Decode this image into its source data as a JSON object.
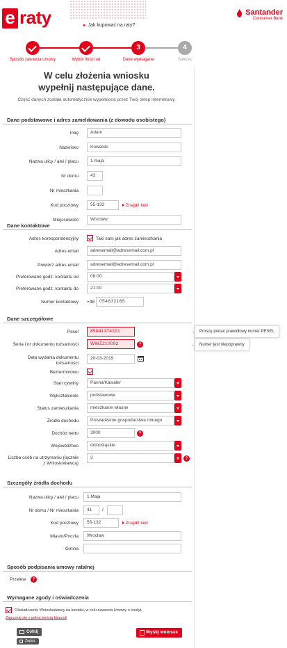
{
  "header": {
    "logo_letter": "e",
    "logo_rest": "raty",
    "howto_link": "Jak kupować na raty?",
    "brand_name": "Santander",
    "brand_sub": "Consumer Bank"
  },
  "steps": [
    {
      "number": "1",
      "label": "Sposób zawarcia umowy",
      "state": "done"
    },
    {
      "number": "2",
      "label": "Wybór ilości rat",
      "state": "done"
    },
    {
      "number": "3",
      "label": "Dane wymagane",
      "state": "active"
    },
    {
      "number": "4",
      "label": "Sukces",
      "state": "future"
    }
  ],
  "page": {
    "title_line1": "W celu złożenia wniosku",
    "title_line2": "wypełnij następujące dane.",
    "subtitle": "Część danych została automatycznie wypełniona przez Twój sklep internetowy."
  },
  "sections": {
    "personal": "Dane podstawowe i adres zameldowania (z dowodu osobistego)",
    "contact": "Dane kontaktowe",
    "details": "Dane szczegółowe",
    "income": "Szczegóły źródła dochodu",
    "signing": "Sposób podpisania umowy ratalnej",
    "consents": "Wymagane zgody i oświadczenia"
  },
  "personal": {
    "first_name_label": "Imię",
    "first_name": "Adam",
    "last_name_label": "Nazwisko",
    "last_name": "Kowalski",
    "street_label": "Nazwa ulicy / alei / placu",
    "street": "1 maja",
    "house_label": "Nr domu",
    "house": "43",
    "apartment_label": "Nr mieszkania",
    "apartment": "",
    "postal_label": "Kod pocztowy",
    "postal": "55-132",
    "find_code": "Znajdź kod",
    "city_label": "Miejscowość",
    "city": "Wrocław"
  },
  "contact": {
    "corr_label": "Adres korespondencyjny",
    "corr_checkbox": "Taki sam jak adres zamieszkania",
    "email_label": "Adres email",
    "email": "adresemail@adresemail.com.pl",
    "email2_label": "Powtórz adres email",
    "email2": "adresemail@adresemail.com.pl",
    "time_from_label": "Preferowane godz. kontaktu od",
    "time_from": "08:00",
    "time_to_label": "Preferowane godz. kontaktu do",
    "time_to": "21:00",
    "phone_label": "Numer kontaktowy",
    "phone_prefix": "+48",
    "phone": "054832165"
  },
  "details": {
    "pesel_label": "Pesel",
    "pesel": "85041374221",
    "pesel_error": "Proszę podać prawidłowy numer PESEL",
    "idno_label": "Seria i nr dokumentu tożsamości",
    "idno": "WWZ210092",
    "idno_error": "Numer jest niepoprawny",
    "issue_label_1": "Data wydania dokumentu",
    "issue_label_2": "tożsamości",
    "issue_date": "20-03-2019",
    "indefinite_label": "Bezterminowo",
    "marital_label": "Stan cywilny",
    "marital": "Panna/Kawaler",
    "education_label": "Wykształcenie",
    "education": "podstawowe",
    "residence_label": "Status zamieszkania",
    "residence": "mieszkanie własne",
    "income_source_label": "Źródło dochodu",
    "income_source": "Prowadzenie gospodarstwa rolnego",
    "net_income_label": "Dochód netto",
    "net_income": "3000",
    "voivodeship_label": "Województwo",
    "voivodeship": "dolnośląskie",
    "dependents_label_1": "Liczba osób na utrzymaniu (łącznie",
    "dependents_label_2": "z Wnioskodawcą)",
    "dependents": "3"
  },
  "income": {
    "street_label": "Nazwa ulicy / alei / placu",
    "street": "1 Maja",
    "house_label": "Nr domu / Nr mieszkania",
    "house": "41",
    "apartment": "",
    "postal_label": "Kod pocztowy",
    "postal": "55-132",
    "find_code": "Znajdź kod",
    "city_label": "Miasto/Poczta",
    "city": "Wrocław",
    "gmina_label": "Gmina",
    "gmina": ""
  },
  "signing": {
    "method": "Przelew"
  },
  "consents": {
    "statement": "Oświadczenie Wnioskodawcy na kontakt, w celu zawarcia Umowy o kredyt.",
    "full_text_link": "Zapoznaj się z pełną treścią klauzuli"
  },
  "buttons": {
    "back": "Cofnij",
    "save": "Zapisz",
    "send": "Wyślij wniosek"
  },
  "help_glyph": "?",
  "colors": {
    "accent": "#e3001b",
    "muted_step": "#a9a9a9"
  }
}
